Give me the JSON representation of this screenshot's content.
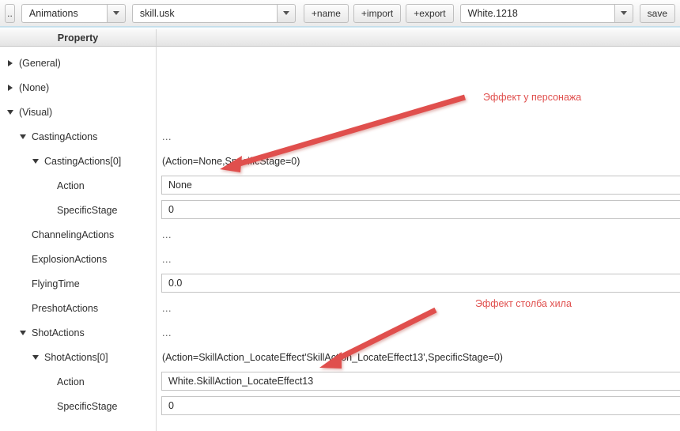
{
  "toolbar": {
    "up_button": "..",
    "animations_combo": "Animations",
    "file_combo": "skill.usk",
    "name_button": "+name",
    "import_button": "+import",
    "export_button": "+export",
    "white_combo": "White.1218",
    "save_button": "save"
  },
  "tree": {
    "header": "Property",
    "items": [
      {
        "label": "(General)",
        "depth": 0,
        "marker": "collapsed"
      },
      {
        "label": "(None)",
        "depth": 0,
        "marker": "collapsed"
      },
      {
        "label": "(Visual)",
        "depth": 0,
        "marker": "expanded"
      },
      {
        "label": "CastingActions",
        "depth": 1,
        "marker": "expanded"
      },
      {
        "label": "CastingActions[0]",
        "depth": 2,
        "marker": "expanded"
      },
      {
        "label": "Action",
        "depth": 3,
        "marker": "none"
      },
      {
        "label": "SpecificStage",
        "depth": 3,
        "marker": "none"
      },
      {
        "label": "ChannelingActions",
        "depth": 1,
        "marker": "none"
      },
      {
        "label": "ExplosionActions",
        "depth": 1,
        "marker": "none"
      },
      {
        "label": "FlyingTime",
        "depth": 1,
        "marker": "none"
      },
      {
        "label": "PreshotActions",
        "depth": 1,
        "marker": "none"
      },
      {
        "label": "ShotActions",
        "depth": 1,
        "marker": "expanded"
      },
      {
        "label": "ShotActions[0]",
        "depth": 2,
        "marker": "expanded"
      },
      {
        "label": "Action",
        "depth": 3,
        "marker": "none"
      },
      {
        "label": "SpecificStage",
        "depth": 3,
        "marker": "none"
      }
    ]
  },
  "values": {
    "rows": [
      {
        "kind": "empty",
        "text": ""
      },
      {
        "kind": "empty",
        "text": ""
      },
      {
        "kind": "empty",
        "text": ""
      },
      {
        "kind": "ellipsis",
        "text": "..."
      },
      {
        "kind": "text",
        "text": "(Action=None,SpecificStage=0)"
      },
      {
        "kind": "input",
        "text": "None"
      },
      {
        "kind": "input",
        "text": "0"
      },
      {
        "kind": "ellipsis",
        "text": "..."
      },
      {
        "kind": "ellipsis",
        "text": "..."
      },
      {
        "kind": "input",
        "text": "0.0"
      },
      {
        "kind": "ellipsis",
        "text": "..."
      },
      {
        "kind": "ellipsis",
        "text": "..."
      },
      {
        "kind": "text",
        "text": "(Action=SkillAction_LocateEffect'SkillAction_LocateEffect13',SpecificStage=0)"
      },
      {
        "kind": "input",
        "text": "White.SkillAction_LocateEffect13"
      },
      {
        "kind": "input",
        "text": "0"
      }
    ]
  },
  "annotations": {
    "character_effect": "Эффект у персонажа",
    "heal_pillar_effect": "Эффект столба хила",
    "color": "#e0504e"
  }
}
